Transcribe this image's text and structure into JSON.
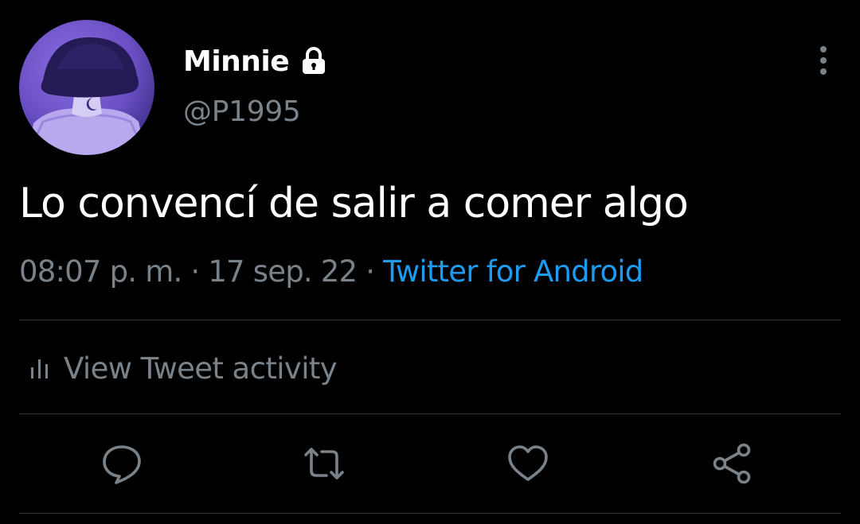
{
  "user": {
    "display_name": "Minnie",
    "handle": "@P1995",
    "protected": true,
    "avatar": "avatar-photo"
  },
  "tweet": {
    "text": "Lo convencí de salir a comer algo",
    "time": "08:07 p. m.",
    "separator": "·",
    "date": "17 sep. 22",
    "source": "Twitter for Android"
  },
  "activity": {
    "label": "View Tweet activity",
    "icon": "bar-chart-icon"
  },
  "actions": {
    "reply_icon": "reply-icon",
    "retweet_icon": "retweet-icon",
    "like_icon": "like-icon",
    "share_icon": "share-icon"
  },
  "colors": {
    "background": "#000000",
    "text": "#ffffff",
    "muted": "#7a8289",
    "link": "#1d9bf0",
    "divider": "#2f3336"
  }
}
